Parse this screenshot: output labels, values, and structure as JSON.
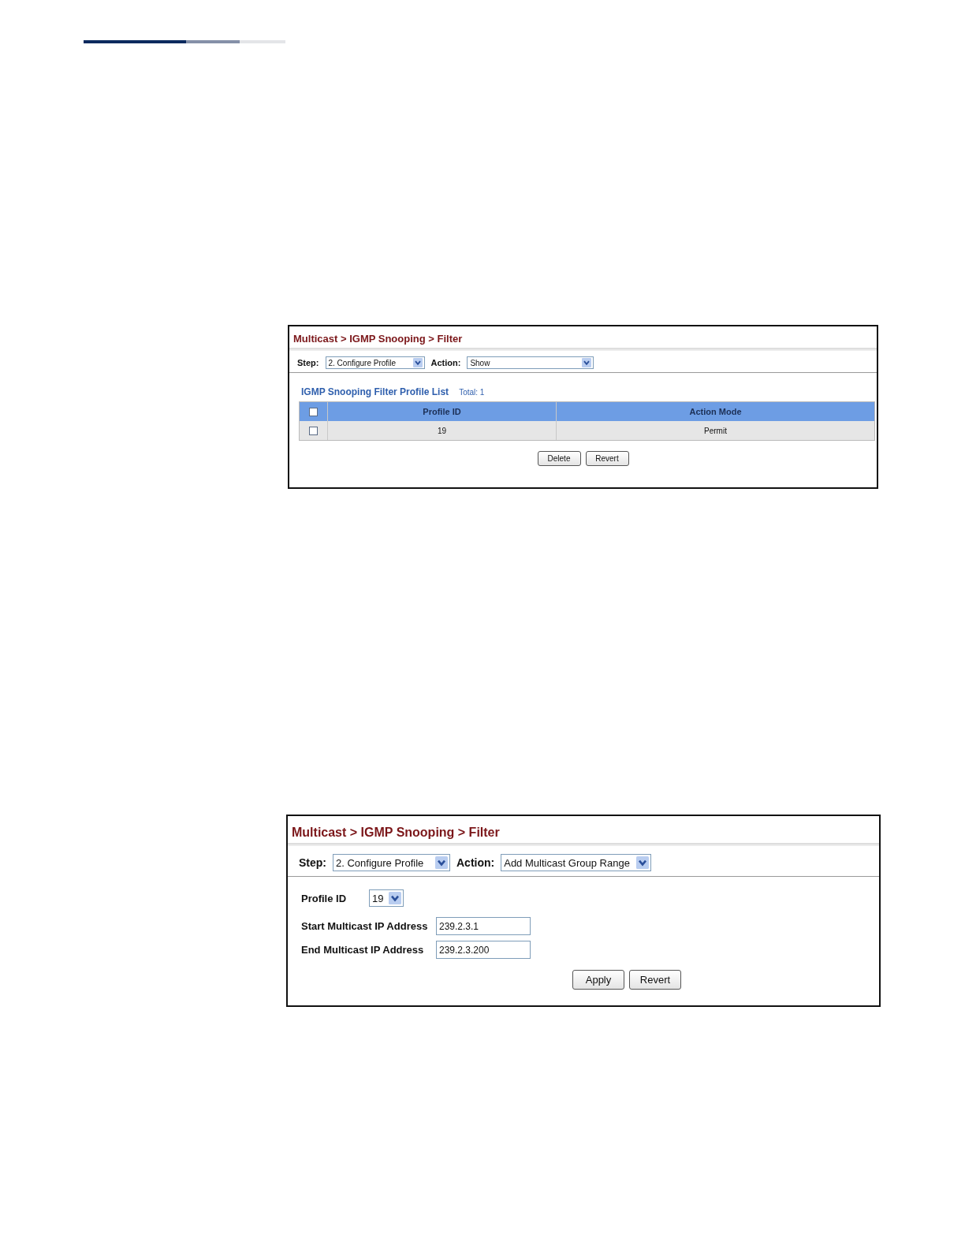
{
  "panels": [
    {
      "kind": "list",
      "breadcrumb": "Multicast > IGMP Snooping > Filter",
      "step": {
        "label": "Step:",
        "value": "2. Configure Profile"
      },
      "action": {
        "label": "Action:",
        "value": "Show"
      },
      "table": {
        "title": "IGMP Snooping Filter Profile List",
        "total": "Total: 1",
        "all_checked": false,
        "columns": [
          "Profile ID",
          "Action Mode"
        ],
        "rows": [
          {
            "checked": false,
            "cells": [
              "19",
              "Permit"
            ]
          }
        ]
      },
      "buttons": [
        "Delete",
        "Revert"
      ]
    },
    {
      "kind": "form",
      "breadcrumb": "Multicast > IGMP Snooping > Filter",
      "step": {
        "label": "Step:",
        "value": "2. Configure Profile"
      },
      "action": {
        "label": "Action:",
        "value": "Add Multicast Group Range"
      },
      "fields": [
        {
          "kind": "select",
          "label": "Profile ID",
          "value": "19"
        },
        {
          "kind": "text",
          "label": "Start Multicast IP Address",
          "value": "239.2.3.1"
        },
        {
          "kind": "text",
          "label": "End Multicast IP Address",
          "value": "239.2.3.200"
        }
      ],
      "buttons": [
        "Apply",
        "Revert"
      ]
    }
  ]
}
